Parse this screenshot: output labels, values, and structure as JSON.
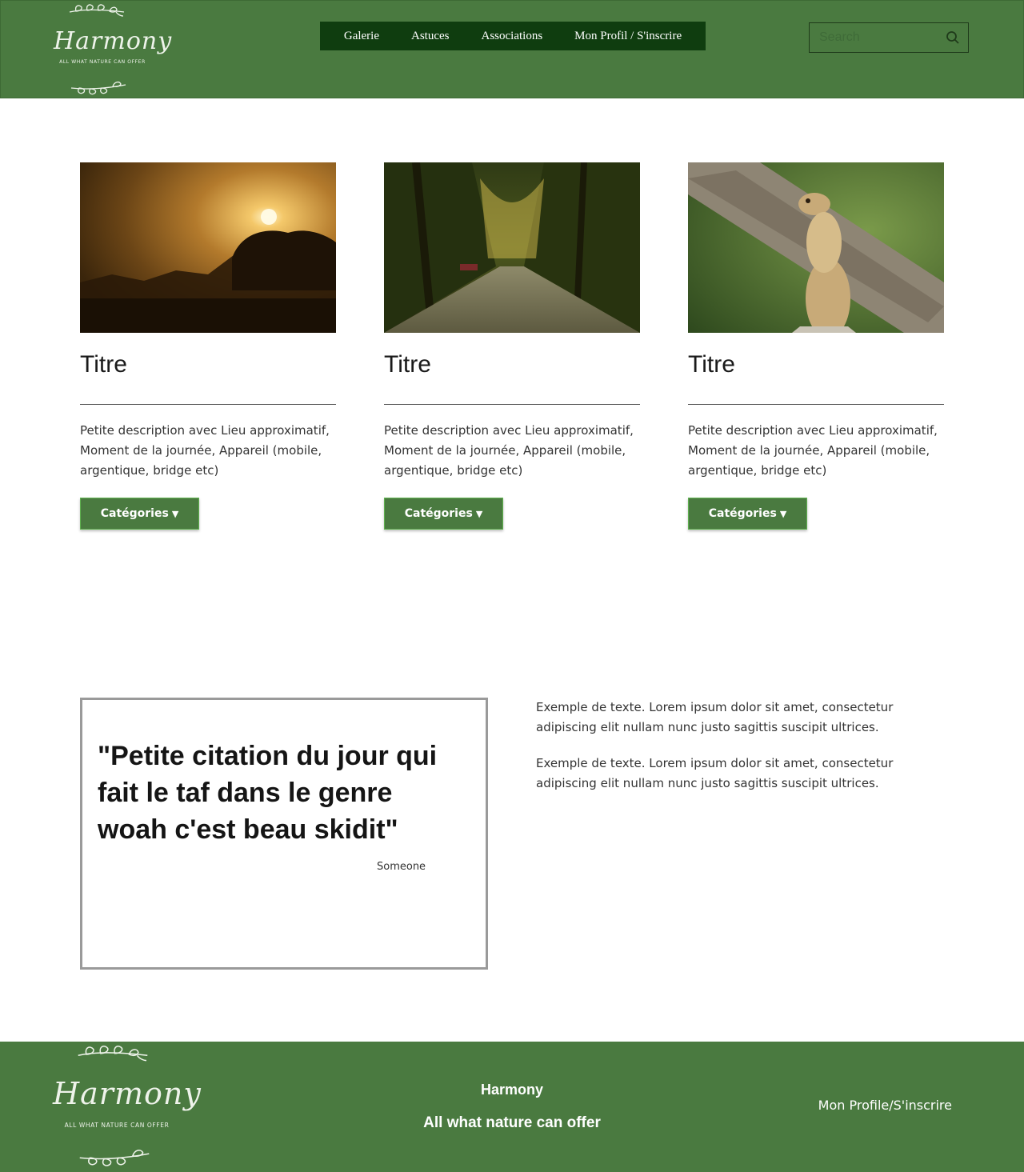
{
  "header": {
    "logo": {
      "name": "Harmony",
      "tagline": "ALL WHAT NATURE CAN OFFER"
    },
    "nav": [
      "Galerie",
      "Astuces",
      "Associations",
      "Mon Profil / S'inscrire"
    ],
    "search": {
      "placeholder": "Search",
      "icon": "search-icon"
    }
  },
  "cards": [
    {
      "image": "sunset-over-trees-photo",
      "title": "Titre",
      "description": "Petite description avec Lieu approximatif, Moment de la journée, Appareil (mobile, argentique, bridge etc)",
      "button": "Catégories"
    },
    {
      "image": "forest-river-photo",
      "title": "Titre",
      "description": "Petite description avec Lieu approximatif, Moment de la journée, Appareil (mobile, argentique, bridge etc)",
      "button": "Catégories"
    },
    {
      "image": "meerkat-photo",
      "title": "Titre",
      "description": "Petite description avec Lieu approximatif, Moment de la journée, Appareil (mobile, argentique, bridge etc)",
      "button": "Catégories"
    }
  ],
  "quote": {
    "text": "\"Petite citation du jour qui fait le taf dans le genre woah c'est beau skidit\"",
    "author": "Someone"
  },
  "side_text": [
    "Exemple de texte. Lorem ipsum dolor sit amet, consectetur adipiscing elit nullam nunc justo sagittis suscipit ultrices.",
    "Exemple de texte. Lorem ipsum dolor sit amet, consectetur adipiscing elit nullam nunc justo sagittis suscipit ultrices."
  ],
  "footer": {
    "logo": {
      "name": "Harmony",
      "tagline": "ALL WHAT NATURE CAN OFFER"
    },
    "name": "Harmony",
    "motto": "All what nature can offer",
    "profile_link": "Mon Profile/S'inscrire"
  },
  "colors": {
    "header_bg": "#4a7a40",
    "nav_bg": "#0f3d0f",
    "button_bg": "#4a7a40",
    "button_border": "#5fb14f",
    "footer_bg": "#4a7a40"
  }
}
